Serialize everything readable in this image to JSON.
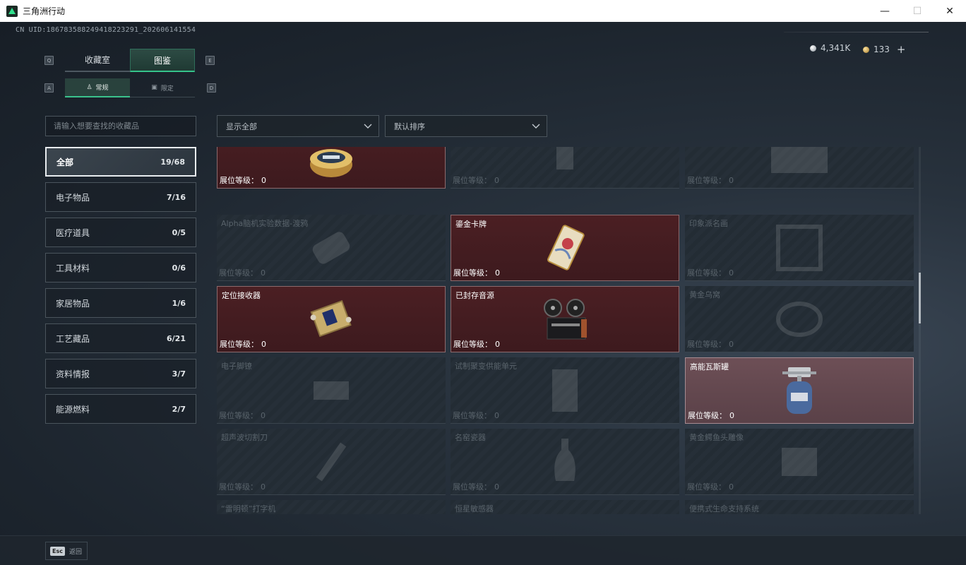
{
  "window": {
    "title": "三角洲行动",
    "minimize": "—",
    "maximize": "☐",
    "close": "✕"
  },
  "uid": "CN UID:18678358824941822329​1_202606141554",
  "currency": {
    "silver": "4,341K",
    "gold": "133",
    "add": "+"
  },
  "keys": {
    "prev_tab": "Q",
    "next_tab": "E",
    "prev_sub": "A",
    "next_sub": "D"
  },
  "tabs": [
    {
      "label": "收藏室"
    },
    {
      "label": "图鉴"
    }
  ],
  "subtabs": [
    {
      "label": "常规",
      "icon": "figure-icon"
    },
    {
      "label": "限定",
      "icon": "image-icon"
    }
  ],
  "search": {
    "placeholder": "请输入想要查找的收藏品"
  },
  "filters": {
    "display": "显示全部",
    "sort": "默认排序"
  },
  "categories": [
    {
      "label": "全部",
      "count": "19/68"
    },
    {
      "label": "电子物品",
      "count": "7/16"
    },
    {
      "label": "医疗道具",
      "count": "0/5"
    },
    {
      "label": "工具材料",
      "count": "0/6"
    },
    {
      "label": "家居物品",
      "count": "1/6"
    },
    {
      "label": "工艺藏品",
      "count": "6/21"
    },
    {
      "label": "资料情报",
      "count": "3/7"
    },
    {
      "label": "能源燃料",
      "count": "2/7"
    }
  ],
  "level_label": "展位等级：",
  "items": [
    {
      "name": "",
      "level": "0",
      "owned": true
    },
    {
      "name": "",
      "level": "0",
      "owned": false
    },
    {
      "name": "",
      "level": "0",
      "owned": false
    },
    {
      "name": "Alpha脑机实验数据-渡鸦",
      "level": "0",
      "owned": false
    },
    {
      "name": "鎏金卡牌",
      "level": "0",
      "owned": true
    },
    {
      "name": "印象派名画",
      "level": "0",
      "owned": false
    },
    {
      "name": "定位接收器",
      "level": "0",
      "owned": true
    },
    {
      "name": "已封存音源",
      "level": "0",
      "owned": true
    },
    {
      "name": "黄金乌窝",
      "level": "0",
      "owned": false
    },
    {
      "name": "电子脚镣",
      "level": "0",
      "owned": false
    },
    {
      "name": "试制聚变供能单元",
      "level": "0",
      "owned": false
    },
    {
      "name": "高能瓦斯罐",
      "level": "0",
      "owned": true
    },
    {
      "name": "超声波切割刀",
      "level": "0",
      "owned": false
    },
    {
      "name": "名窑瓷器",
      "level": "0",
      "owned": false
    },
    {
      "name": "黄金鳄鱼头雕像",
      "level": "0",
      "owned": false
    },
    {
      "name": "“雷明顿”打字机",
      "level": "",
      "owned": false
    },
    {
      "name": "恒星敏感器",
      "level": "",
      "owned": false
    },
    {
      "name": "便携式生命支持系统",
      "level": "",
      "owned": false
    }
  ],
  "bottom": {
    "esc_key": "Esc",
    "back": "返回"
  }
}
